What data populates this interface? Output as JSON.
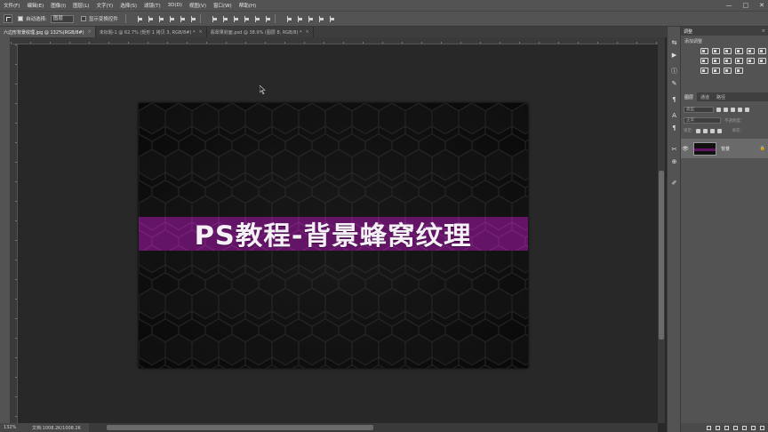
{
  "menu": [
    "文件(F)",
    "编辑(E)",
    "图像(I)",
    "图层(L)",
    "文字(Y)",
    "选择(S)",
    "滤镜(T)",
    "3D(D)",
    "视图(V)",
    "窗口(W)",
    "帮助(H)"
  ],
  "window_controls": {
    "minimize": "—",
    "maximize": "□",
    "close": "✕"
  },
  "options": {
    "auto_select_label": "自动选择:",
    "auto_select_value": "图层",
    "transform_label": "显示变换控件"
  },
  "tabs": [
    {
      "label": "六边形背景纹理.jpg @ 132%(RGB/8#)",
      "close": "×"
    },
    {
      "label": "未标题-1 @ 62.7% (矩形 1 拷贝 3, RGB/8#) *",
      "close": "×"
    },
    {
      "label": "翡翠果封面.psd @ 38.9% (图层 8, RGB/8) *",
      "close": "×"
    }
  ],
  "canvas": {
    "banner_text": "PS教程-背景蜂窝纹理",
    "banner_color": "#641466",
    "background_color": "#111111"
  },
  "status": {
    "zoom": "132%",
    "doc_info": "文档:1008.2K/1008.2K"
  },
  "panels": {
    "adjustments_title": "调整",
    "adjustments_subtitle": "添加调整",
    "layers_tabs": [
      "图层",
      "通道",
      "路径"
    ],
    "kind_placeholder": "类型",
    "blend_mode": "正常",
    "opacity_label": "不透明度:",
    "lock_label": "锁定:",
    "fill_label": "填充:",
    "layer_name": "背景"
  }
}
